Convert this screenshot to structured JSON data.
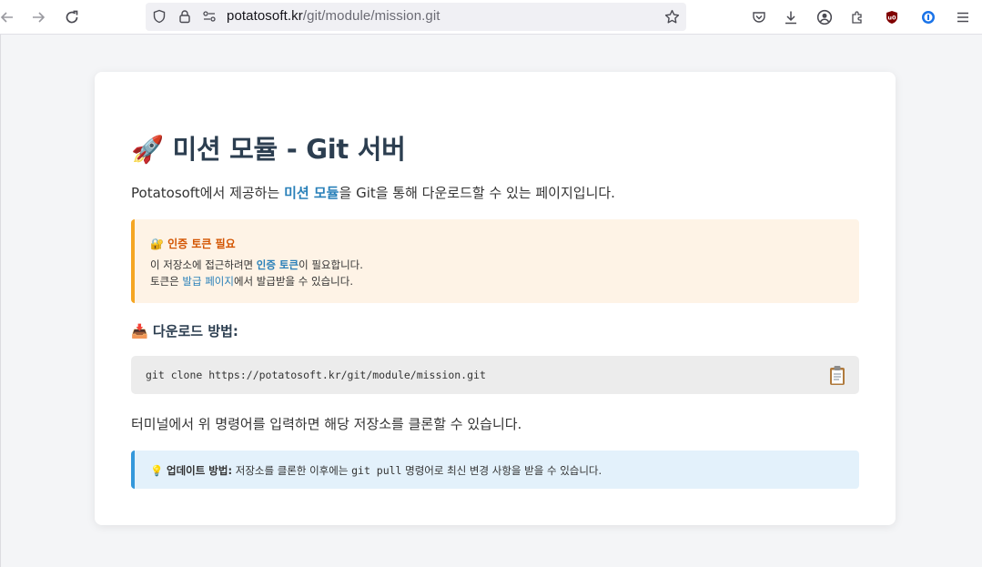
{
  "browser": {
    "url_domain": "potatosoft.kr",
    "url_path": "/git/module/mission.git"
  },
  "page": {
    "title": "🚀 미션 모듈 - Git 서버",
    "intro_before": "Potatosoft에서 제공하는 ",
    "intro_highlight": "미션 모듈",
    "intro_after": "을 Git을 통해 다운로드할 수 있는 페이지입니다.",
    "auth_box": {
      "title": "🔐 인증 토큰 필요",
      "line1_before": "이 저장소에 접근하려면 ",
      "line1_bold": "인증 토큰",
      "line1_after": "이 필요합니다.",
      "line2_before": "토큰은 ",
      "line2_link": "발급 페이지",
      "line2_after": "에서 발급받을 수 있습니다."
    },
    "download_heading": "📥 다운로드 방법:",
    "clone_command": "git clone https://potatosoft.kr/git/module/mission.git",
    "after_text": "터미널에서 위 명령어를 입력하면 해당 저장소를 클론할 수 있습니다.",
    "update_box": {
      "emoji": "💡 ",
      "label": "업데이트 방법:",
      "text_before": " 저장소를 클론한 이후에는 ",
      "command": "git pull",
      "text_after": " 명령어로 최신 변경 사항을 받을 수 있습니다."
    }
  }
}
